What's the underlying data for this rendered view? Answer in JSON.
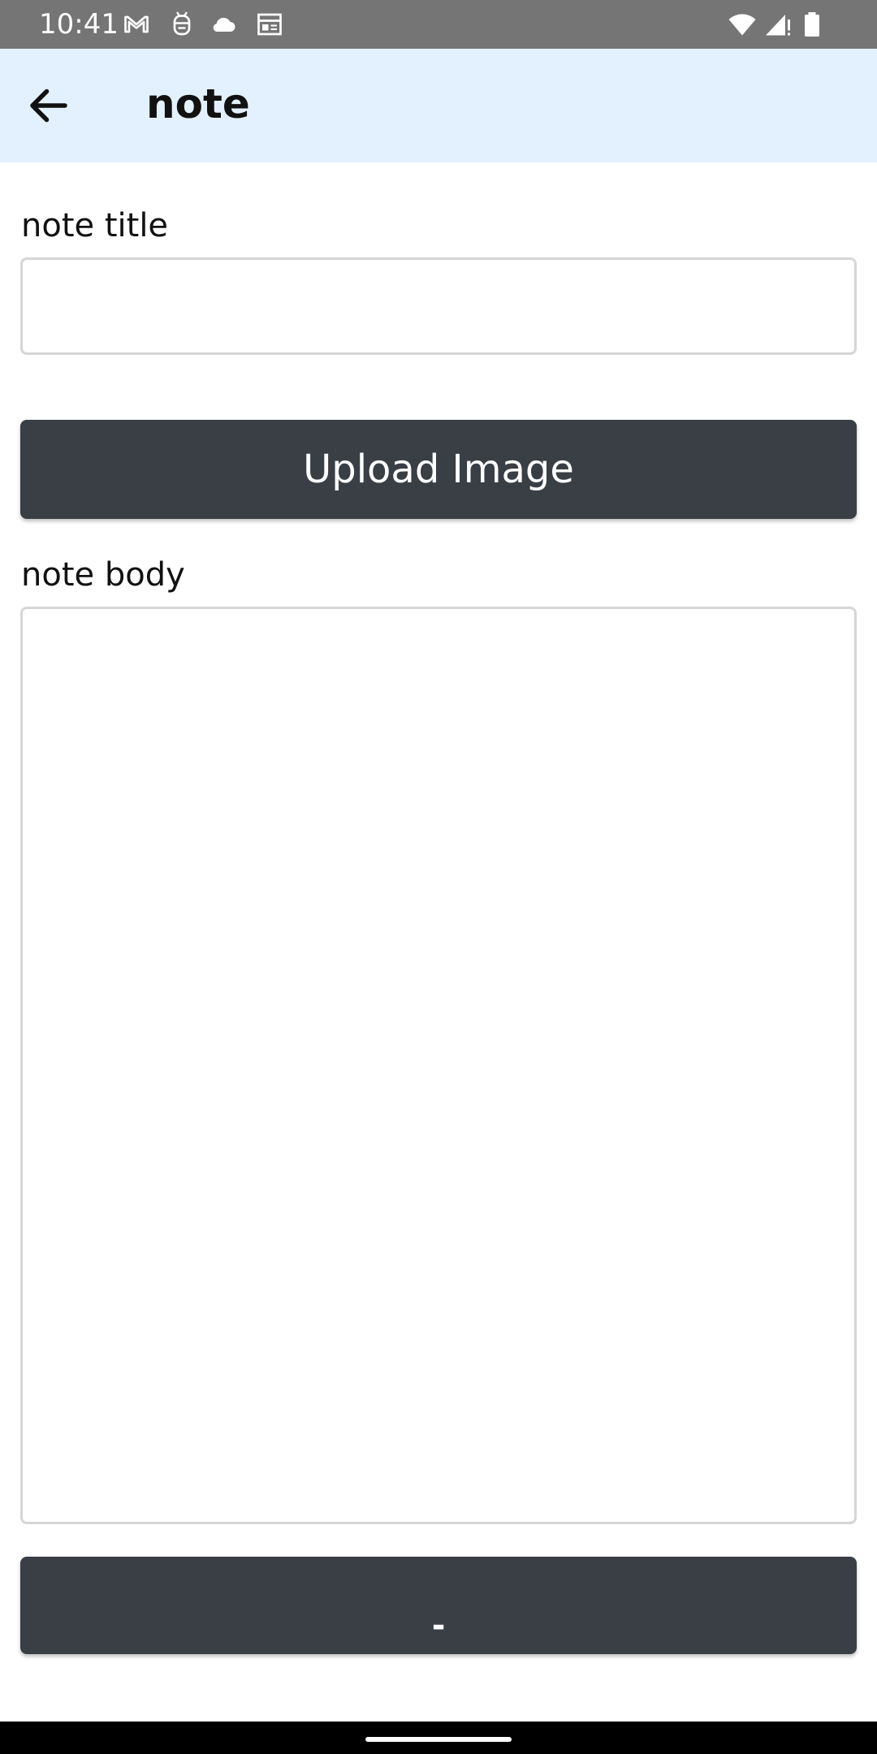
{
  "status_bar": {
    "time": "10:41",
    "left_icons": [
      "gmail-icon",
      "android-debug-icon",
      "cloud-icon",
      "calendar-icon"
    ],
    "right_icons": [
      "wifi-icon",
      "cell-signal-icon",
      "battery-icon"
    ]
  },
  "app_bar": {
    "back_icon": "arrow-back-icon",
    "title": "note"
  },
  "form": {
    "title_label": "note title",
    "title_value": "",
    "upload_button_label": "Upload Image",
    "body_label": "note body",
    "body_value": "",
    "submit_button_label": "-"
  },
  "colors": {
    "status_bar": "#757575",
    "app_bar": "#e3f0fd",
    "button": "#3a3e45",
    "input_border": "#d6d6d6"
  }
}
